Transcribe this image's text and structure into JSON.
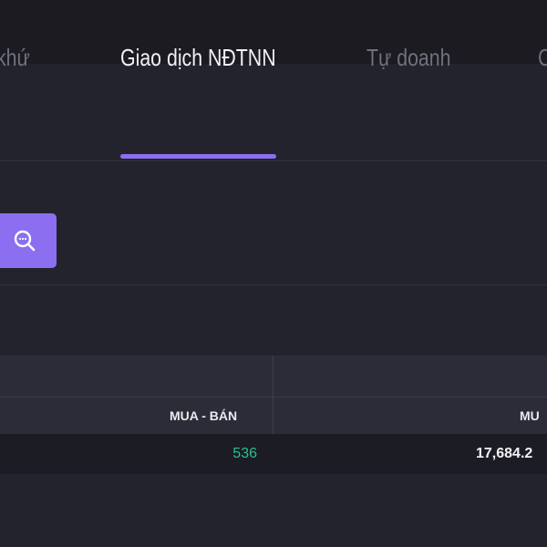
{
  "tabs": [
    {
      "label": "khứ",
      "active": false
    },
    {
      "label": "Giao dịch NĐTNN",
      "active": true
    },
    {
      "label": "Tự doanh",
      "active": false
    },
    {
      "label": "C",
      "active": false
    }
  ],
  "search_button": {
    "icon": "search-icon"
  },
  "table": {
    "headers": [
      "MUA - BÁN",
      "MU"
    ],
    "rows": [
      [
        "536",
        "17,684.2"
      ]
    ]
  },
  "colors": {
    "accent": "#8b6ff0",
    "positive": "#22c58b",
    "background": "#23232e"
  }
}
